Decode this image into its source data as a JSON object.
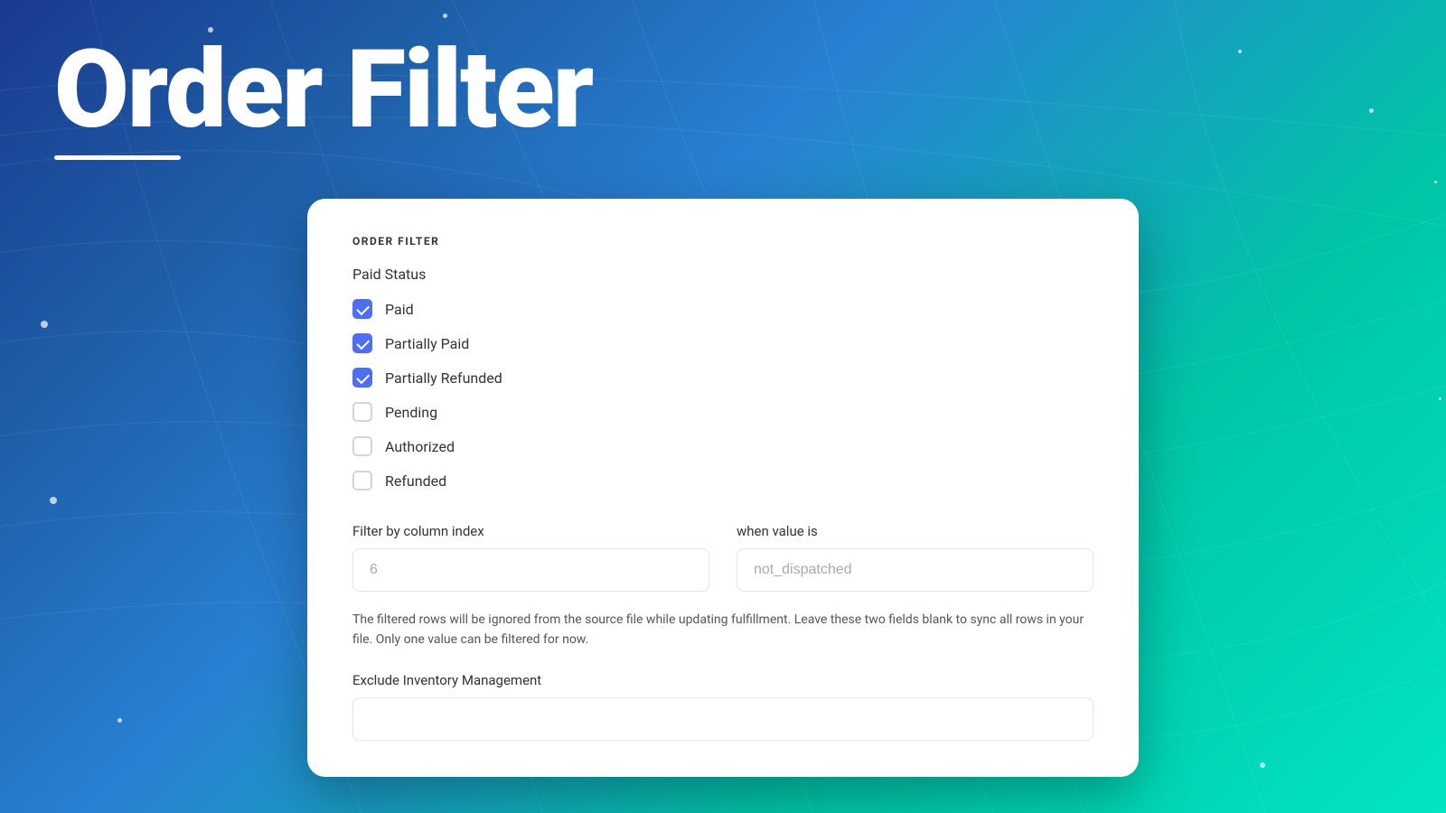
{
  "background": {
    "gradient_start": "#1a3a8f",
    "gradient_end": "#00e5c4"
  },
  "header": {
    "title": "Order Filter",
    "underline": true
  },
  "card": {
    "section_title": "ORDER FILTER",
    "paid_status_label": "Paid Status",
    "checkboxes": [
      {
        "id": "paid",
        "label": "Paid",
        "checked": true
      },
      {
        "id": "partially-paid",
        "label": "Partially Paid",
        "checked": true
      },
      {
        "id": "partially-refunded",
        "label": "Partially Refunded",
        "checked": true
      },
      {
        "id": "pending",
        "label": "Pending",
        "checked": false
      },
      {
        "id": "authorized",
        "label": "Authorized",
        "checked": false
      },
      {
        "id": "refunded",
        "label": "Refunded",
        "checked": false
      }
    ],
    "filter_column": {
      "label": "Filter by column index",
      "placeholder": "6",
      "value": ""
    },
    "filter_value": {
      "label": "when value is",
      "placeholder": "not_dispatched",
      "value": ""
    },
    "filter_note": "The filtered rows will be ignored from the source file while updating fulfillment. Leave these two fields blank to sync all rows in your file. Only one value can be filtered for now.",
    "exclude_label": "Exclude Inventory Management",
    "exclude_placeholder": ""
  }
}
